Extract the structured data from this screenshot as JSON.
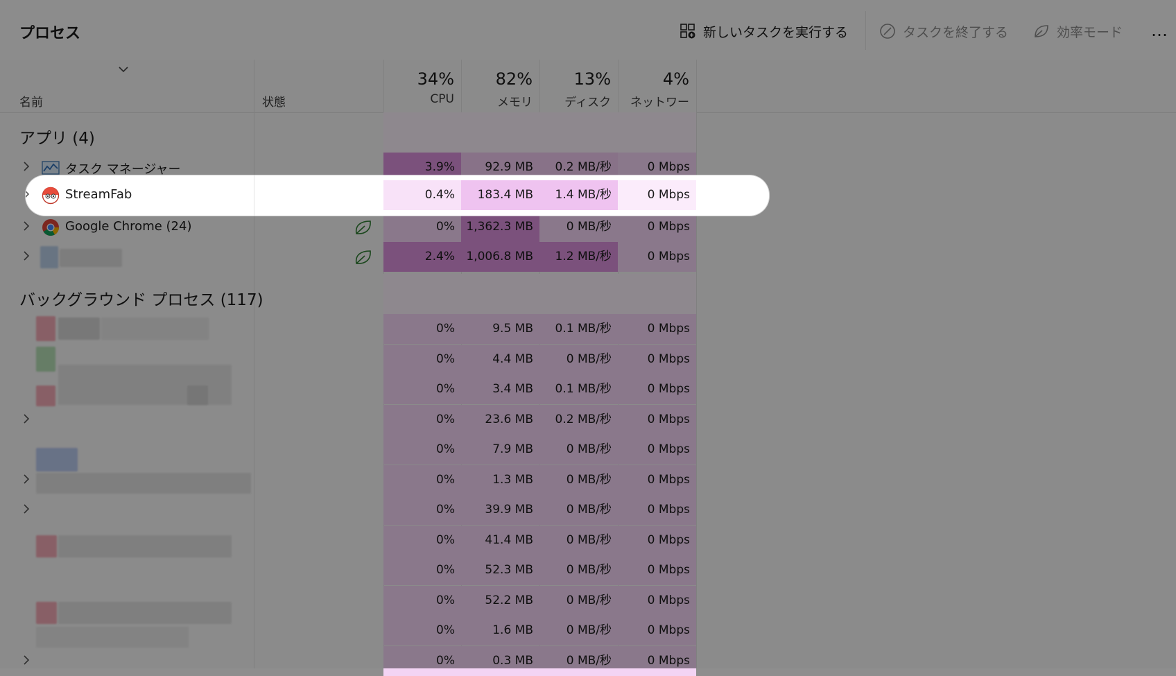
{
  "toolbar": {
    "title": "プロセス",
    "new_task": "新しいタスクを実行する",
    "end_task": "タスクを終了する",
    "efficiency_mode": "効率モード",
    "more": "…"
  },
  "columns": {
    "name": "名前",
    "status": "状態",
    "cpu_pct": "34%",
    "cpu_label": "CPU",
    "mem_pct": "82%",
    "mem_label": "メモリ",
    "disk_pct": "13%",
    "disk_label": "ディスク",
    "net_pct": "4%",
    "net_label": "ネットワーク"
  },
  "apps": {
    "title": "アプリ (4)",
    "rows": [
      {
        "name": "タスク マネージャー",
        "cpu": "3.9%",
        "mem": "92.9 MB",
        "disk": "0.2 MB/秒",
        "net": "0 Mbps"
      },
      {
        "name": "StreamFab",
        "cpu": "0.4%",
        "mem": "183.4 MB",
        "disk": "1.4 MB/秒",
        "net": "0 Mbps"
      },
      {
        "name": "Google Chrome (24)",
        "cpu": "0%",
        "mem": "1,362.3 MB",
        "disk": "0 MB/秒",
        "net": "0 Mbps"
      },
      {
        "name": "",
        "cpu": "2.4%",
        "mem": "1,006.8 MB",
        "disk": "1.2 MB/秒",
        "net": "0 Mbps"
      }
    ]
  },
  "background": {
    "title": "バックグラウンド プロセス (117)",
    "rows": [
      {
        "cpu": "0%",
        "mem": "9.5 MB",
        "disk": "0.1 MB/秒",
        "net": "0 Mbps"
      },
      {
        "cpu": "0%",
        "mem": "4.4 MB",
        "disk": "0 MB/秒",
        "net": "0 Mbps"
      },
      {
        "cpu": "0%",
        "mem": "3.4 MB",
        "disk": "0.1 MB/秒",
        "net": "0 Mbps"
      },
      {
        "cpu": "0%",
        "mem": "23.6 MB",
        "disk": "0.2 MB/秒",
        "net": "0 Mbps"
      },
      {
        "cpu": "0%",
        "mem": "7.9 MB",
        "disk": "0 MB/秒",
        "net": "0 Mbps"
      },
      {
        "cpu": "0%",
        "mem": "1.3 MB",
        "disk": "0 MB/秒",
        "net": "0 Mbps"
      },
      {
        "cpu": "0%",
        "mem": "39.9 MB",
        "disk": "0 MB/秒",
        "net": "0 Mbps"
      },
      {
        "cpu": "0%",
        "mem": "41.4 MB",
        "disk": "0 MB/秒",
        "net": "0 Mbps"
      },
      {
        "cpu": "0%",
        "mem": "52.3 MB",
        "disk": "0 MB/秒",
        "net": "0 Mbps"
      },
      {
        "cpu": "0%",
        "mem": "52.2 MB",
        "disk": "0 MB/秒",
        "net": "0 Mbps"
      },
      {
        "cpu": "0%",
        "mem": "1.6 MB",
        "disk": "0 MB/秒",
        "net": "0 Mbps"
      },
      {
        "cpu": "0%",
        "mem": "0.3 MB",
        "disk": "0 MB/秒",
        "net": "0 Mbps"
      }
    ]
  },
  "colors": {
    "heat_light": "#f3d4f4",
    "heat_mid": "#e9b6ea",
    "heat_strong": "#d98fdb",
    "highlight": "#ffffff"
  }
}
